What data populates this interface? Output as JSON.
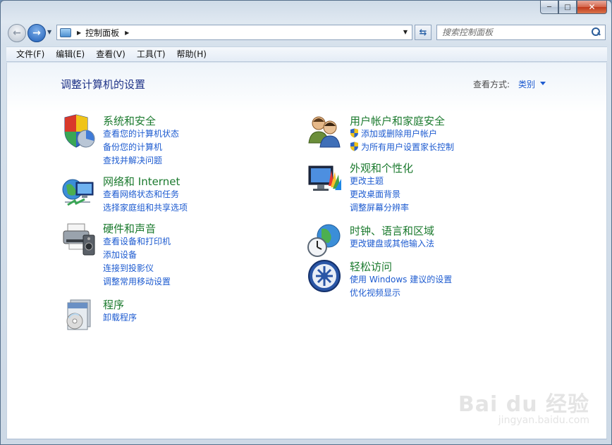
{
  "window": {
    "address": {
      "segment": "控制面板"
    },
    "search": {
      "placeholder": "搜索控制面板"
    },
    "caption": {
      "minimize": "─",
      "maximize": "□",
      "close": "✕"
    }
  },
  "menu": [
    {
      "label": "文件(F)"
    },
    {
      "label": "编辑(E)"
    },
    {
      "label": "查看(V)"
    },
    {
      "label": "工具(T)"
    },
    {
      "label": "帮助(H)"
    }
  ],
  "content": {
    "title": "调整计算机的设置",
    "view_by_label": "查看方式:",
    "view_by_value": "类别",
    "categories": {
      "system": {
        "title": "系统和安全",
        "icon": "system-security-icon",
        "links": [
          "查看您的计算机状态",
          "备份您的计算机",
          "查找并解决问题"
        ]
      },
      "network": {
        "title": "网络和 Internet",
        "icon": "network-icon",
        "links": [
          "查看网络状态和任务",
          "选择家庭组和共享选项"
        ]
      },
      "hardware": {
        "title": "硬件和声音",
        "icon": "hardware-sound-icon",
        "links": [
          "查看设备和打印机",
          "添加设备",
          "连接到投影仪",
          "调整常用移动设置"
        ]
      },
      "programs": {
        "title": "程序",
        "icon": "programs-icon",
        "links": [
          "卸载程序"
        ]
      },
      "accounts": {
        "title": "用户帐户和家庭安全",
        "icon": "user-accounts-icon",
        "links": [
          "添加或删除用户帐户",
          "为所有用户设置家长控制"
        ]
      },
      "appearance": {
        "title": "外观和个性化",
        "icon": "appearance-icon",
        "links": [
          "更改主题",
          "更改桌面背景",
          "调整屏幕分辨率"
        ]
      },
      "clock": {
        "title": "时钟、语言和区域",
        "icon": "clock-region-icon",
        "links": [
          "更改键盘或其他输入法"
        ]
      },
      "ease": {
        "title": "轻松访问",
        "icon": "ease-of-access-icon",
        "links": [
          "使用 Windows 建议的设置",
          "优化视频显示"
        ]
      }
    }
  },
  "watermark": {
    "logo": "Bai du 经验",
    "url": "jingyan.baidu.com"
  }
}
